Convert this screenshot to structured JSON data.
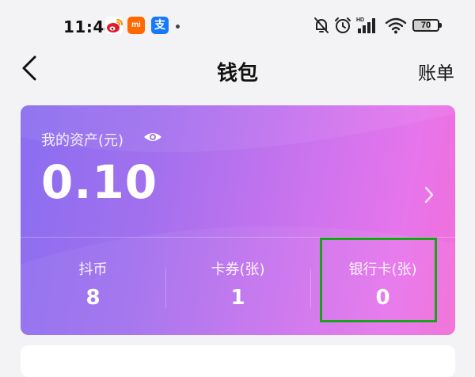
{
  "status_bar": {
    "time": "11:44",
    "apps": [
      "weibo-icon",
      "mi-icon",
      "alipay-icon"
    ],
    "mi_label": "mi",
    "alipay_label": "支",
    "battery": "70",
    "battery_level": 0.7,
    "signal_label": "HD",
    "icons": [
      "bell-off-icon",
      "alarm-icon",
      "signal-icon",
      "wifi-icon",
      "battery-icon"
    ]
  },
  "nav": {
    "title": "钱包",
    "right_link": "账单",
    "back_icon": "chevron-left-icon"
  },
  "assets": {
    "label": "我的资产(元)",
    "value": "0.10",
    "visibility_icon": "eye-icon",
    "detail_icon": "chevron-right-icon"
  },
  "stats": [
    {
      "label": "抖币",
      "value": "8"
    },
    {
      "label": "卡券(张)",
      "value": "1"
    },
    {
      "label": "银行卡(张)",
      "value": "0"
    }
  ],
  "colors": {
    "card_gradient_start": "#8a6ef0",
    "card_gradient_end": "#f26ed8",
    "highlight": "#1aa21a",
    "page_background": "#f3f3f5"
  }
}
